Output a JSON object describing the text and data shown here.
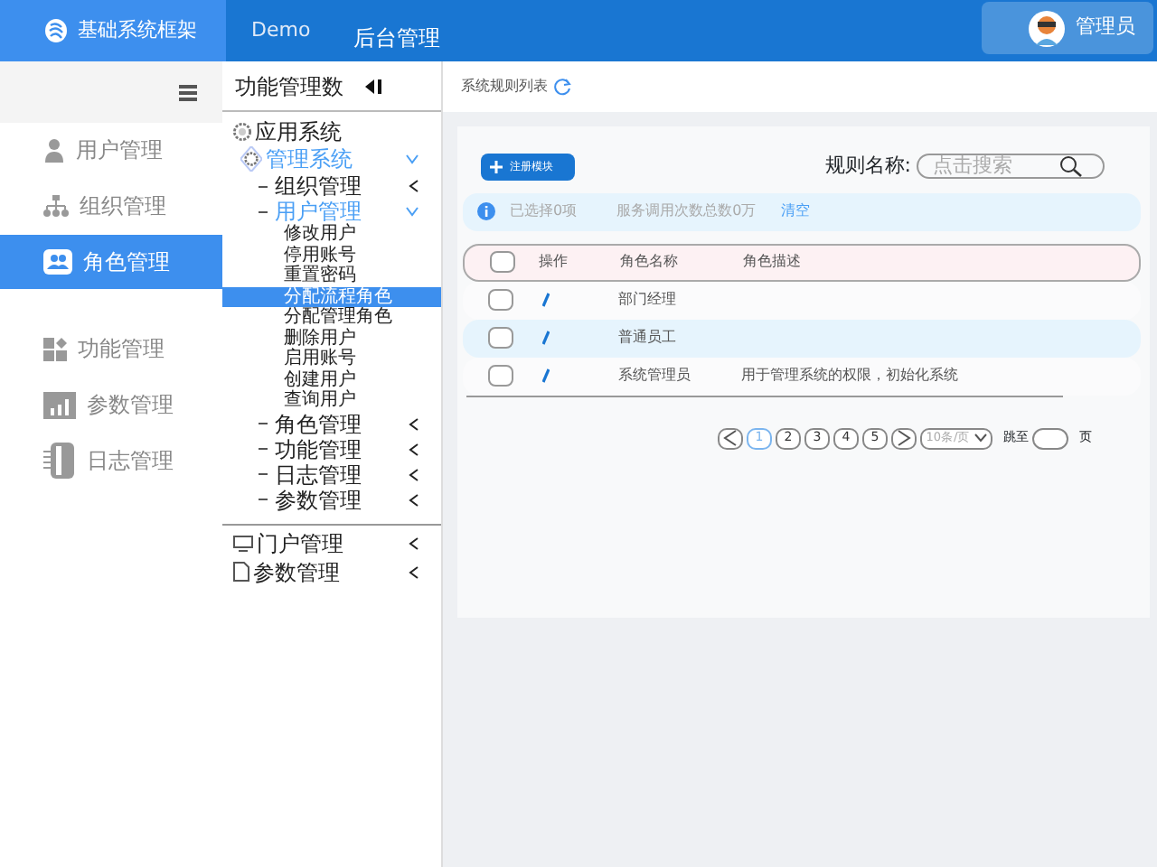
{
  "header": {
    "logo_text": "基础系统框架",
    "nav": [
      {
        "label": "Demo",
        "selected": false
      },
      {
        "label": "后台管理",
        "selected": true
      }
    ],
    "user": "管理员"
  },
  "sidebar": {
    "items": [
      {
        "label": "用户管理",
        "selected": false
      },
      {
        "label": "组织管理",
        "selected": false
      },
      {
        "label": "角色管理",
        "selected": true
      },
      {
        "label": "功能管理",
        "selected": false
      },
      {
        "label": "参数管理",
        "selected": false
      },
      {
        "label": "日志管理",
        "selected": false
      }
    ]
  },
  "tree": {
    "title": "功能管理数",
    "sections": [
      {
        "nodes": [
          {
            "label": "应用系统",
            "kind": "root",
            "children": [
              {
                "label": "管理系统",
                "kind": "system",
                "expanded": true,
                "children": [
                  {
                    "label": "组织管理",
                    "kind": "branch",
                    "expanded": false
                  },
                  {
                    "label": "用户管理",
                    "kind": "branch",
                    "expanded": true,
                    "children": [
                      {
                        "label": "修改用户",
                        "kind": "leaf",
                        "selected": false
                      },
                      {
                        "label": "停用账号",
                        "kind": "leaf",
                        "selected": false
                      },
                      {
                        "label": "重置密码",
                        "kind": "leaf",
                        "selected": false
                      },
                      {
                        "label": "分配流程角色",
                        "kind": "leaf",
                        "selected": true
                      },
                      {
                        "label": "分配管理角色",
                        "kind": "leaf",
                        "selected": false
                      },
                      {
                        "label": "删除用户",
                        "kind": "leaf",
                        "selected": false
                      },
                      {
                        "label": "启用账号",
                        "kind": "leaf",
                        "selected": false
                      },
                      {
                        "label": "创建用户",
                        "kind": "leaf",
                        "selected": false
                      },
                      {
                        "label": "查询用户",
                        "kind": "leaf",
                        "selected": false
                      }
                    ]
                  },
                  {
                    "label": "角色管理",
                    "kind": "branch",
                    "expanded": false
                  },
                  {
                    "label": "功能管理",
                    "kind": "branch",
                    "expanded": false
                  },
                  {
                    "label": "日志管理",
                    "kind": "branch",
                    "expanded": false
                  },
                  {
                    "label": "参数管理",
                    "kind": "branch",
                    "expanded": false
                  }
                ]
              }
            ]
          }
        ]
      },
      {
        "nodes": [
          {
            "label": "门户管理",
            "kind": "monitor",
            "expanded": false
          },
          {
            "label": "参数管理",
            "kind": "document",
            "expanded": false
          }
        ]
      }
    ]
  },
  "breadcrumb": "系统规则列表",
  "toolbar": {
    "button": "注册模块",
    "search_label": "规则名称:",
    "search_placeholder": "点击搜索"
  },
  "info_bar": {
    "selected_text": "已选择0项",
    "total_text": "服务调用次数总数0万",
    "clear_link": "清空"
  },
  "table": {
    "header_checked": false,
    "columns": [
      "操作",
      "角色名称",
      "角色描述"
    ],
    "rows": [
      {
        "checked": false,
        "highlighted": false,
        "name": "部门经理"
      },
      {
        "checked": false,
        "highlighted": true,
        "name": "普通员工"
      },
      {
        "checked": false,
        "highlighted": false,
        "name": "系统管理员",
        "description": "用于管理系统的权限，初始化系统"
      }
    ]
  },
  "pagination": {
    "pages": [
      {
        "label": "1",
        "selected": true
      },
      {
        "label": "2",
        "selected": false
      },
      {
        "label": "3",
        "selected": false
      },
      {
        "label": "4",
        "selected": false
      },
      {
        "label": "5",
        "selected": false
      }
    ],
    "page_size": "10条/页",
    "jump_label": "跳至",
    "page_suffix": "页"
  }
}
